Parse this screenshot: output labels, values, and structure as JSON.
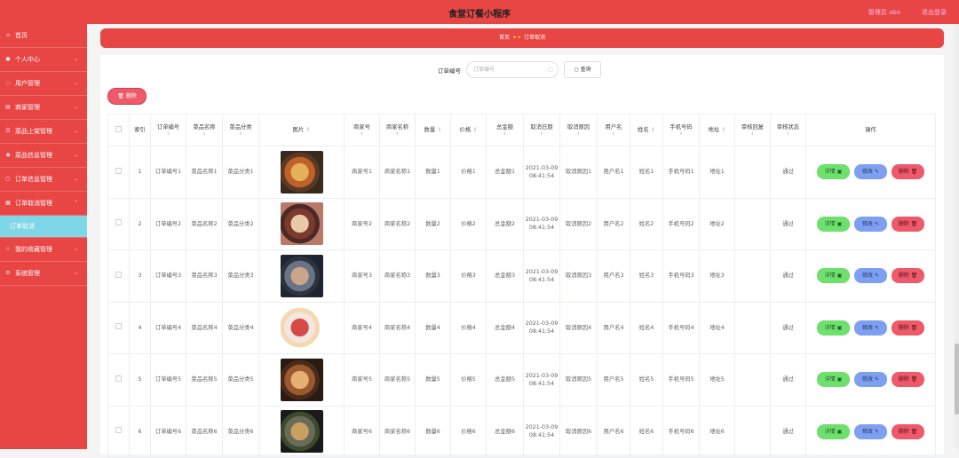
{
  "header": {
    "title": "食堂订餐小程序",
    "user": "管理员 abo",
    "logout": "退出登录"
  },
  "sidebar": {
    "items": [
      {
        "label": "首页",
        "icon": "home-icon"
      },
      {
        "label": "个人中心",
        "icon": "user-icon"
      },
      {
        "label": "用户管理",
        "icon": "users-icon"
      },
      {
        "label": "商家管理",
        "icon": "shop-icon"
      },
      {
        "label": "菜品上架管理",
        "icon": "list-icon"
      },
      {
        "label": "菜品信息管理",
        "icon": "dish-icon"
      },
      {
        "label": "订单信息管理",
        "icon": "order-icon"
      },
      {
        "label": "订单取消管理",
        "icon": "cancel-icon"
      },
      {
        "label": "订单取消",
        "icon": ""
      },
      {
        "label": "我的收藏管理",
        "icon": "star-icon"
      },
      {
        "label": "系统管理",
        "icon": "gear-icon"
      }
    ]
  },
  "breadcrumb": {
    "home": "首页",
    "current": "订单取消"
  },
  "search": {
    "label": "订单编号",
    "placeholder": "订单编号",
    "button": "查询"
  },
  "toolbar": {
    "delete_label": "删除"
  },
  "table": {
    "headers": [
      "索引",
      "订单编号",
      "菜品名称",
      "菜品分类",
      "图片",
      "商家号",
      "商家名称",
      "数量",
      "价格",
      "总金额",
      "取消日期",
      "取消原因",
      "用户名",
      "姓名",
      "手机号码",
      "地址",
      "审核回复",
      "审核状态",
      "操作"
    ],
    "rows": [
      {
        "idx": "1",
        "order_no": "订单编号1",
        "dish": "菜品名称1",
        "category": "菜品分类1",
        "merchant_no": "商家号1",
        "merchant": "商家名称1",
        "qty": "数量1",
        "price": "价格1",
        "total": "总金额1",
        "date": "2021-03-09 08:41:54",
        "reason": "取消原因1",
        "username": "用户名1",
        "name": "姓名1",
        "phone": "手机号码1",
        "address": "地址1",
        "reply": "",
        "status": "通过",
        "img": "food-plate-1"
      },
      {
        "idx": "2",
        "order_no": "订单编号2",
        "dish": "菜品名称2",
        "category": "菜品分类2",
        "merchant_no": "商家号2",
        "merchant": "商家名称2",
        "qty": "数量2",
        "price": "价格2",
        "total": "总金额2",
        "date": "2021-03-09 08:41:54",
        "reason": "取消原因2",
        "username": "用户名2",
        "name": "姓名2",
        "phone": "手机号码2",
        "address": "地址2",
        "reply": "",
        "status": "通过",
        "img": "food-plate-2"
      },
      {
        "idx": "3",
        "order_no": "订单编号3",
        "dish": "菜品名称3",
        "category": "菜品分类3",
        "merchant_no": "商家号3",
        "merchant": "商家名称3",
        "qty": "数量3",
        "price": "价格3",
        "total": "总金额3",
        "date": "2021-03-09 08:41:54",
        "reason": "取消原因3",
        "username": "用户名3",
        "name": "姓名3",
        "phone": "手机号码3",
        "address": "地址3",
        "reply": "",
        "status": "通过",
        "img": "food-plate-3"
      },
      {
        "idx": "4",
        "order_no": "订单编号4",
        "dish": "菜品名称4",
        "category": "菜品分类4",
        "merchant_no": "商家号4",
        "merchant": "商家名称4",
        "qty": "数量4",
        "price": "价格4",
        "total": "总金额4",
        "date": "2021-03-09 08:41:54",
        "reason": "取消原因4",
        "username": "用户名4",
        "name": "姓名4",
        "phone": "手机号码4",
        "address": "地址4",
        "reply": "",
        "status": "通过",
        "img": "food-plate-4"
      },
      {
        "idx": "5",
        "order_no": "订单编号5",
        "dish": "菜品名称5",
        "category": "菜品分类5",
        "merchant_no": "商家号5",
        "merchant": "商家名称5",
        "qty": "数量5",
        "price": "价格5",
        "total": "总金额5",
        "date": "2021-03-09 08:41:54",
        "reason": "取消原因5",
        "username": "用户名5",
        "name": "姓名5",
        "phone": "手机号码5",
        "address": "地址5",
        "reply": "",
        "status": "通过",
        "img": "food-plate-5"
      },
      {
        "idx": "6",
        "order_no": "订单编号6",
        "dish": "菜品名称6",
        "category": "菜品分类6",
        "merchant_no": "商家号6",
        "merchant": "商家名称6",
        "qty": "数量6",
        "price": "价格6",
        "total": "总金额6",
        "date": "2021-03-09 08:41:54",
        "reason": "取消原因6",
        "username": "用户名6",
        "name": "姓名6",
        "phone": "手机号码6",
        "address": "地址6",
        "reply": "",
        "status": "通过",
        "img": "food-plate-6"
      }
    ],
    "actions": {
      "detail": "详情",
      "edit": "修改",
      "delete": "删除"
    }
  },
  "colors": {
    "primary": "#e84545",
    "active_sub": "#7ed6e6",
    "detail": "#6ee06e",
    "edit": "#7ea0f0",
    "delete": "#ef5a6a"
  }
}
